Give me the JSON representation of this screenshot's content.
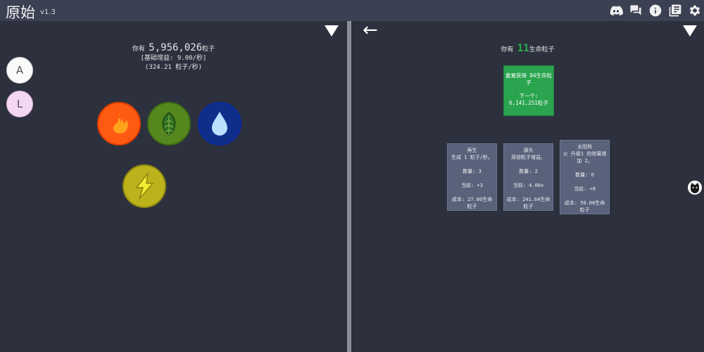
{
  "app": {
    "title": "原始",
    "version": "v1.3"
  },
  "top_icons": [
    "discord-icon",
    "chat-icon",
    "info-icon",
    "changelog-icon",
    "settings-icon"
  ],
  "side_buttons": {
    "a_label": "A",
    "l_label": "L"
  },
  "left_panel": {
    "particles_prefix": "你有",
    "particles_value": "5,956,026",
    "particles_unit": "粒子",
    "base_gain": "[基础增益: 9.00/秒]",
    "rate": "(324.21 粒子/秒)"
  },
  "elements": [
    "fire-element",
    "leaf-element",
    "water-element",
    "lightning-element"
  ],
  "right_panel": {
    "life_prefix": "你有",
    "life_value": "11",
    "life_unit": "生命粒子",
    "reset_card": {
      "line1": "重置获得 84生命粒子",
      "next_label": "下一个:",
      "next_value": "6,141,251粒子"
    },
    "upgrades": [
      {
        "title": "再生",
        "desc": "生成 1 粒子/秒。",
        "amount": "数量: 3",
        "current": "当前: +3",
        "cost": "成本: 27.00生命粒子"
      },
      {
        "title": "源头",
        "desc": "双倍粒子增益。",
        "amount": "数量: 2",
        "current": "当前: 4.00x",
        "cost": "成本: 241.64生命粒子"
      },
      {
        "title": "太阳热",
        "desc": "火 升级1 的效果增加 2。",
        "amount": "数量: 0",
        "current": "当前: +0",
        "cost": "成本: 50.00生命粒子"
      }
    ]
  },
  "colors": {
    "accent_green": "#2bb14a",
    "topbar": "#3b4052",
    "background": "#2d313d"
  }
}
